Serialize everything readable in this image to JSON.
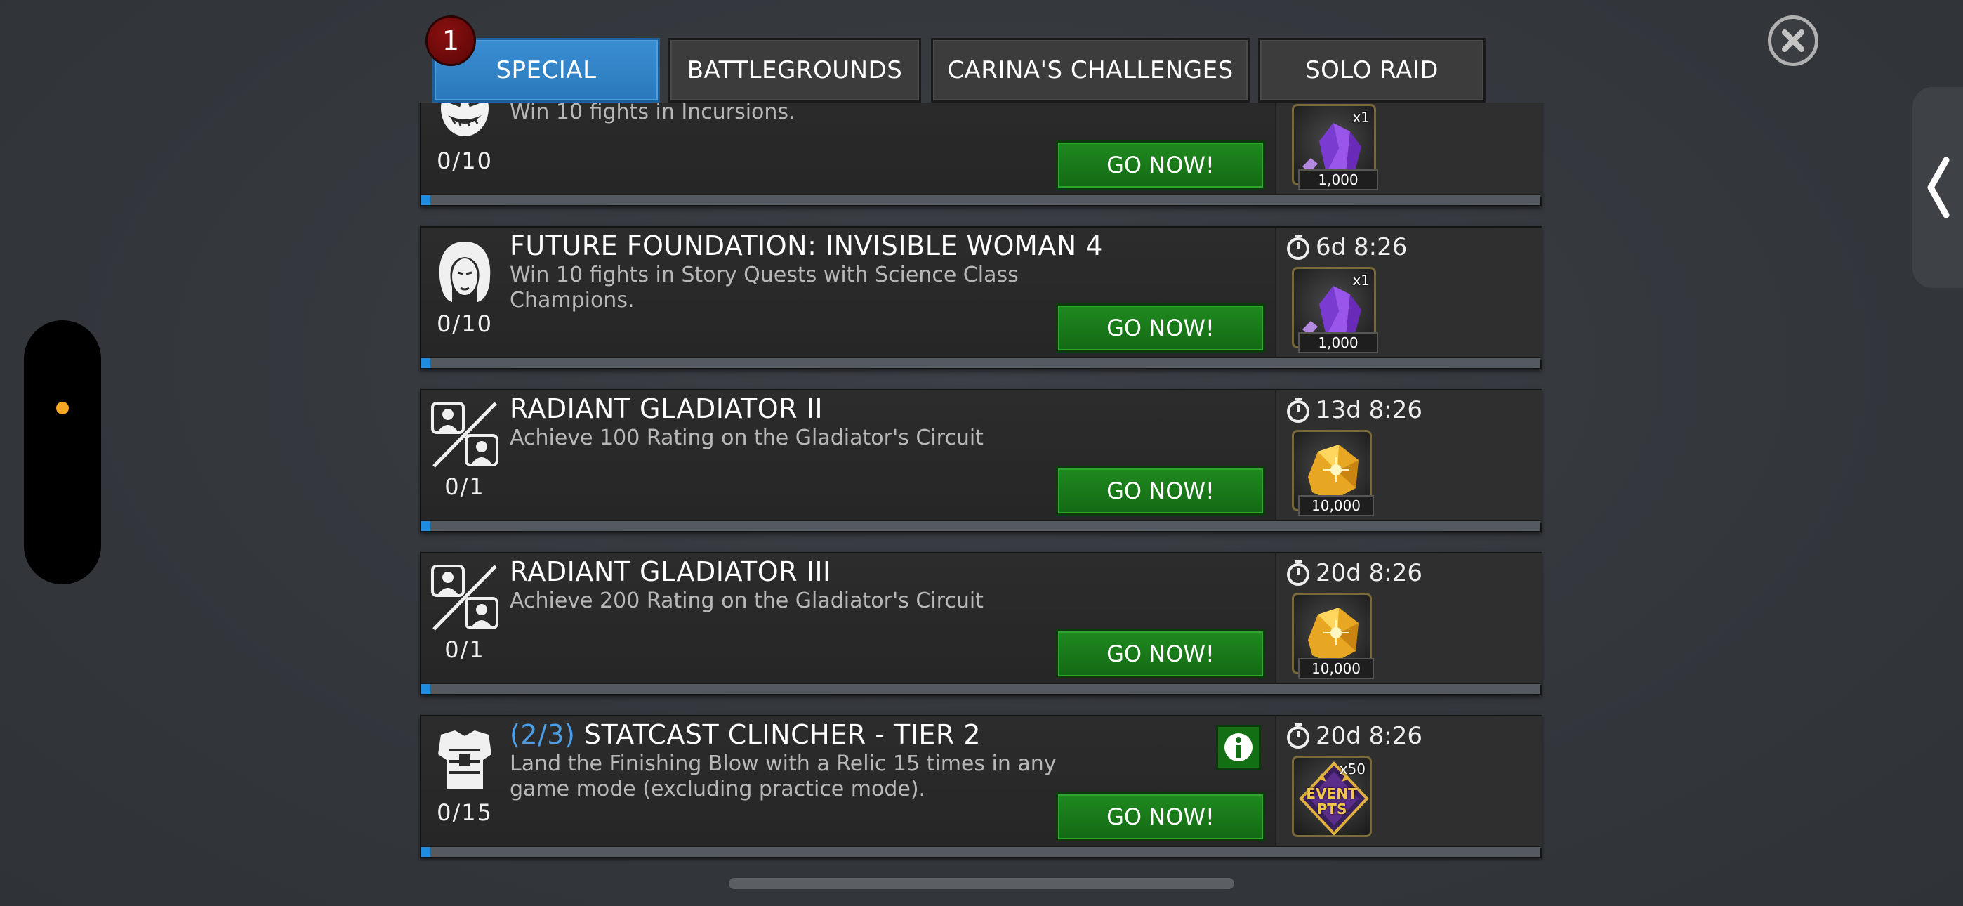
{
  "tabs": [
    {
      "label": "SPECIAL",
      "active": true
    },
    {
      "label": "BATTLEGROUNDS",
      "active": false
    },
    {
      "label": "CARINA'S CHALLENGES",
      "active": false
    },
    {
      "label": "SOLO RAID",
      "active": false
    }
  ],
  "tab_badge": "1",
  "colors": {
    "tab_active": "#2f80c4",
    "go_button": "#1a7d1a",
    "progress": "#1f8ce0",
    "badge": "#7a0b0b",
    "title_prefix": "#4a9fe8"
  },
  "quests": [
    {
      "title": "",
      "description": "Win 10 fights in Incursions.",
      "progress": "0/10",
      "progress_fraction": 0,
      "icon": "villain-face-icon",
      "button": "GO NOW!",
      "timer": "",
      "reward": {
        "icon": "purple-crystal-icon",
        "qty": "x1",
        "amount": "1,000"
      }
    },
    {
      "title": "FUTURE FOUNDATION: INVISIBLE WOMAN 4",
      "description": "Win 10 fights in Story Quests with Science Class Champions.",
      "progress": "0/10",
      "progress_fraction": 0,
      "icon": "invisible-woman-face-icon",
      "button": "GO NOW!",
      "timer": "6d 8:26",
      "reward": {
        "icon": "purple-crystal-icon",
        "qty": "x1",
        "amount": "1,000"
      }
    },
    {
      "title": "RADIANT GLADIATOR II",
      "description": "Achieve 100 Rating on the Gladiator's Circuit",
      "progress": "0/1",
      "progress_fraction": 0,
      "icon": "gladiator-versus-icon",
      "button": "GO NOW!",
      "timer": "13d 8:26",
      "reward": {
        "icon": "gold-gem-icon",
        "qty": "",
        "amount": "10,000"
      }
    },
    {
      "title": "RADIANT GLADIATOR III",
      "description": "Achieve 200 Rating on the Gladiator's Circuit",
      "progress": "0/1",
      "progress_fraction": 0,
      "icon": "gladiator-versus-icon",
      "button": "GO NOW!",
      "timer": "20d 8:26",
      "reward": {
        "icon": "gold-gem-icon",
        "qty": "",
        "amount": "10,000"
      }
    },
    {
      "title_prefix": "(2/3)",
      "title": "STATCAST CLINCHER - TIER 2",
      "description": "Land the Finishing Blow with a Relic 15 times in any game mode (excluding practice mode).",
      "progress": "0/15",
      "progress_fraction": 0,
      "icon": "relic-armor-icon",
      "button": "GO NOW!",
      "timer": "20d 8:26",
      "has_info": true,
      "reward": {
        "icon": "event-pts-icon",
        "qty": "x50",
        "amount": "",
        "label": "EVENT PTS"
      }
    }
  ]
}
